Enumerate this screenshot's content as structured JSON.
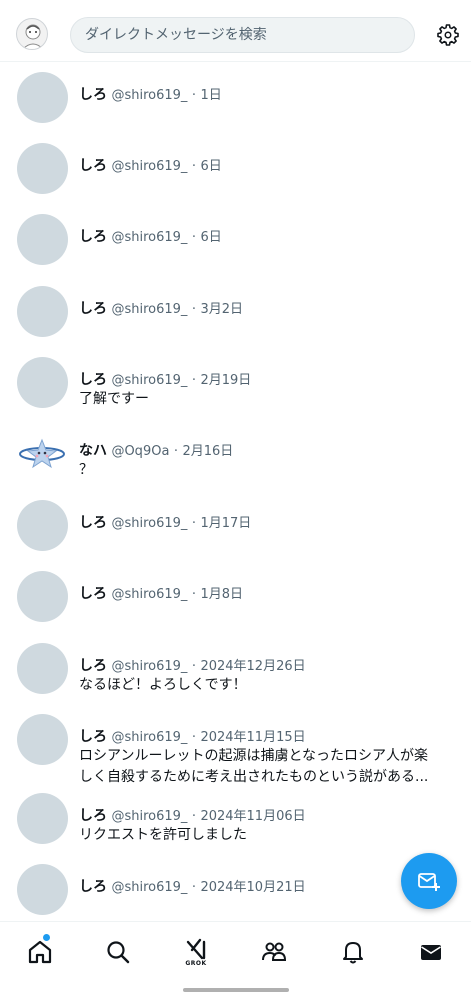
{
  "header": {
    "search_placeholder": "ダイレクトメッセージを検索",
    "settings_icon": "gear-icon",
    "avatar_icon": "profile-avatar"
  },
  "conversations": [
    {
      "name": "しろ",
      "handle": "@shiro619_",
      "sep": "·",
      "date": "1日",
      "message": ""
    },
    {
      "name": "しろ",
      "handle": "@shiro619_",
      "sep": "·",
      "date": "6日",
      "message": ""
    },
    {
      "name": "しろ",
      "handle": "@shiro619_",
      "sep": "·",
      "date": "6日",
      "message": ""
    },
    {
      "name": "しろ",
      "handle": "@shiro619_",
      "sep": "·",
      "date": "3月2日",
      "message": ""
    },
    {
      "name": "しろ",
      "handle": "@shiro619_",
      "sep": "·",
      "date": "2月19日",
      "message": "了解ですー"
    },
    {
      "name": "なハ",
      "handle": "@Oq9Oa",
      "sep": "·",
      "date": "2月16日",
      "message": "？"
    },
    {
      "name": "しろ",
      "handle": "@shiro619_",
      "sep": "·",
      "date": "1月17日",
      "message": ""
    },
    {
      "name": "しろ",
      "handle": "@shiro619_",
      "sep": "·",
      "date": "1月8日",
      "message": ""
    },
    {
      "name": "しろ",
      "handle": "@shiro619_",
      "sep": "·",
      "date": "2024年12月26日",
      "message": "なるほど！よろしくです！"
    },
    {
      "name": "しろ",
      "handle": "@shiro619_",
      "sep": "·",
      "date": "2024年11月15日",
      "message": "ロシアンルーレットの起源は捕虜となったロシア人が楽しく自殺するために考え出されたものという説がある..."
    },
    {
      "name": "しろ",
      "handle": "@shiro619_",
      "sep": "·",
      "date": "2024年11月06日",
      "message": "リクエストを許可しました"
    },
    {
      "name": "しろ",
      "handle": "@shiro619_",
      "sep": "·",
      "date": "2024年10月21日",
      "message": ""
    }
  ],
  "fab": {
    "icon": "new-message-icon"
  },
  "bottom_nav": {
    "items": [
      "home-icon",
      "search-icon",
      "grok-icon",
      "communities-icon",
      "notifications-icon",
      "messages-icon"
    ],
    "grok_label": "GROK",
    "accent_color": "#1d9bf0"
  }
}
